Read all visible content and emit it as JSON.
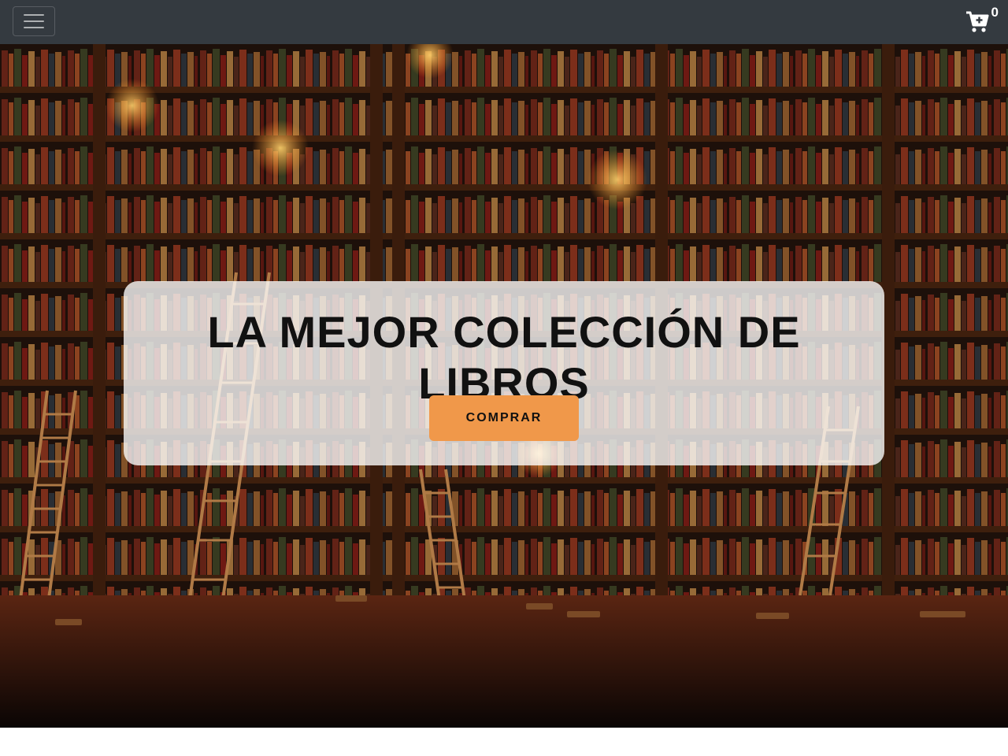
{
  "navbar": {
    "toggle_icon": "hamburger-menu-icon",
    "cart_icon": "cart-plus-icon",
    "cart_count": "0",
    "background": "#343a40"
  },
  "hero": {
    "title": "LA MEJOR COLECCIÓN DE LIBROS",
    "button_label": "COMPRAR",
    "button_color": "#f0984a",
    "background_image": "library-bookshelves-ladders-candles"
  }
}
